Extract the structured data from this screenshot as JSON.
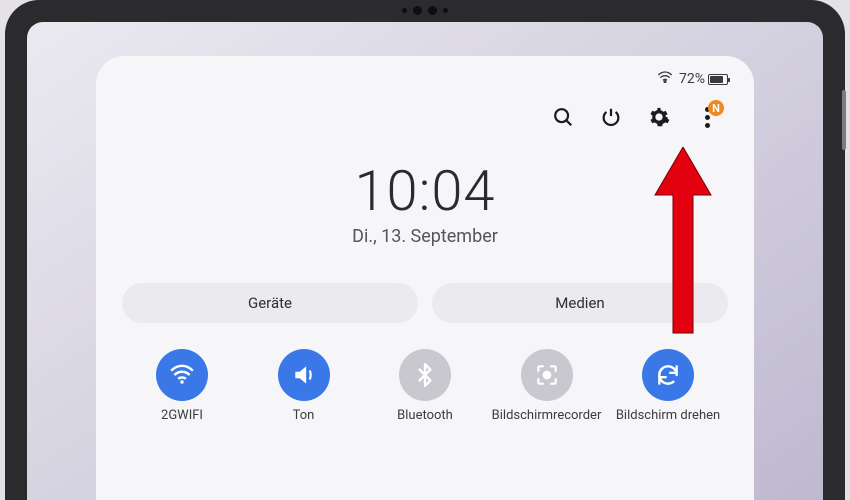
{
  "status": {
    "battery_pct": "72%",
    "battery_level": 72
  },
  "actions": {
    "badge_text": "N"
  },
  "clock": {
    "time": "10:04",
    "date": "Di., 13. September"
  },
  "segments": {
    "devices_label": "Geräte",
    "media_label": "Medien"
  },
  "quicksettings": {
    "wifi": {
      "label": "2GWIFI",
      "active": true
    },
    "sound": {
      "label": "Ton",
      "active": true
    },
    "bt": {
      "label": "Bluetooth",
      "active": false
    },
    "rec": {
      "label": "Bildschirmrecorder",
      "active": false
    },
    "rotate": {
      "label": "Bildschirm drehen",
      "active": true
    }
  },
  "colors": {
    "accent_blue": "#3a78e7",
    "badge_orange": "#ef8a1f",
    "annotation_red": "#e3000f"
  }
}
